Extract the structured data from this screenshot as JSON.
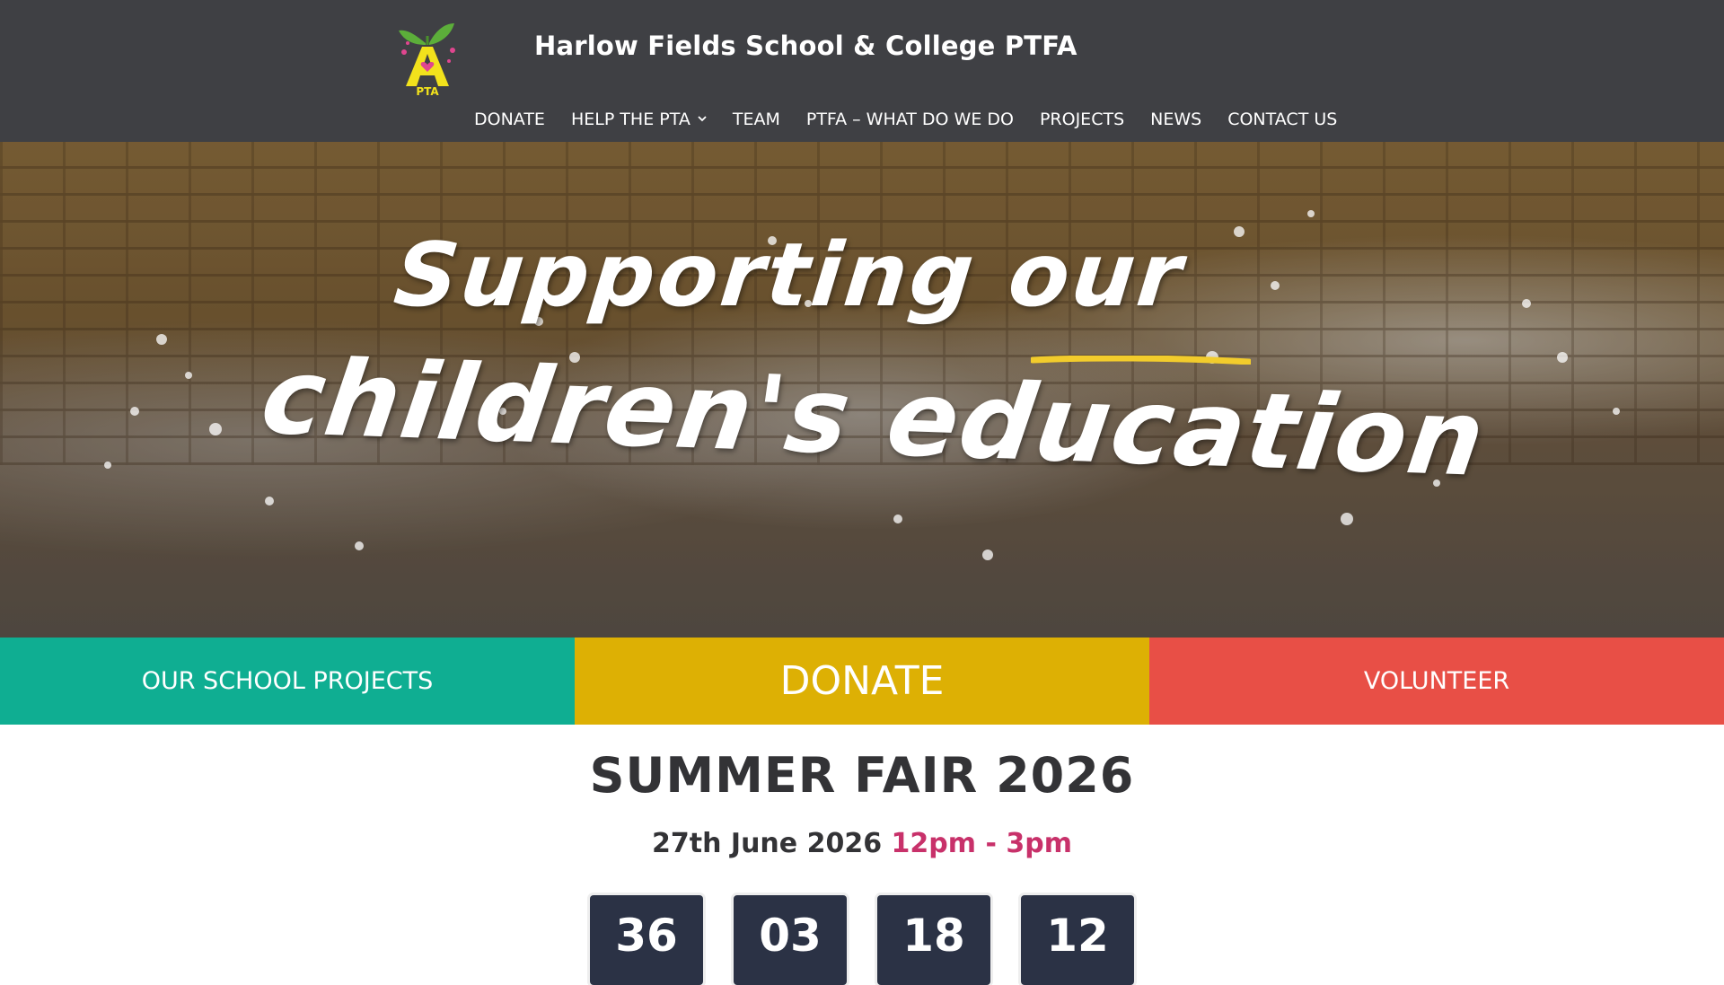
{
  "header": {
    "site_title": "Harlow Fields School & College PTFA",
    "logo_text": "PTA",
    "background_color": "#3f4044"
  },
  "nav": {
    "items": [
      {
        "label": "DONATE"
      },
      {
        "label": "HELP THE PTA",
        "has_dropdown": true
      },
      {
        "label": "TEAM"
      },
      {
        "label": "PTFA – WHAT DO WE DO"
      },
      {
        "label": "PROJECTS"
      },
      {
        "label": "NEWS"
      },
      {
        "label": "CONTACT US"
      }
    ]
  },
  "hero": {
    "line1_a": "Supporting",
    "line1_b": "our",
    "line2": "children's education"
  },
  "cta": {
    "projects": "OUR SCHOOL PROJECTS",
    "donate": "DONATE",
    "volunteer": "VOLUNTEER",
    "colors": {
      "projects": "#0fae92",
      "donate": "#ddb004",
      "volunteer": "#e84f46"
    }
  },
  "event": {
    "title": "SUMMER FAIR 2026",
    "date": "27th June 2026",
    "time": "12pm - 3pm",
    "time_color": "#c8316a"
  },
  "countdown": {
    "values": [
      "36",
      "03",
      "18",
      "12"
    ]
  }
}
